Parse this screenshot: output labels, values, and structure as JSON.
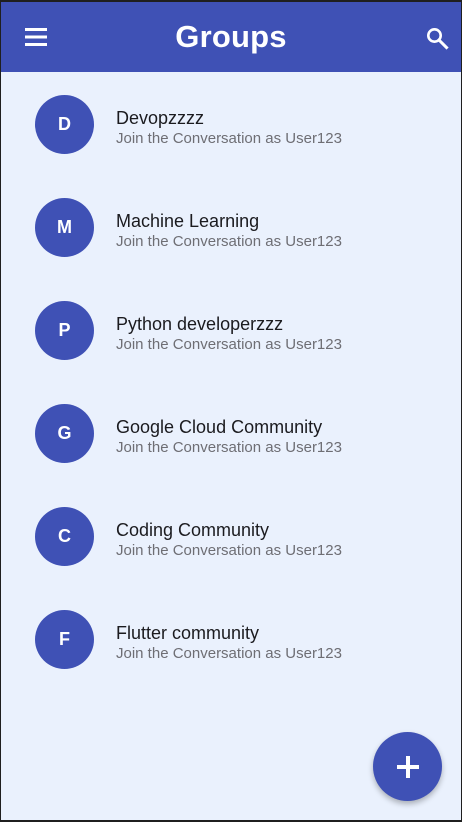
{
  "colors": {
    "primary": "#3f51b5",
    "background": "#eaf1fd",
    "on_primary": "#ffffff",
    "title_text": "#1b1b1f",
    "subtitle_text": "#6e6e74"
  },
  "app_bar": {
    "title": "Groups",
    "leading_icon": "menu-icon",
    "trailing_icon": "search-icon"
  },
  "groups": [
    {
      "initial": "D",
      "name": "Devopzzzz",
      "subtitle": "Join the Conversation as User123"
    },
    {
      "initial": "M",
      "name": "Machine Learning",
      "subtitle": "Join the Conversation as User123"
    },
    {
      "initial": "P",
      "name": "Python developerzzz",
      "subtitle": "Join the Conversation as User123"
    },
    {
      "initial": "G",
      "name": "Google Cloud Community",
      "subtitle": "Join the Conversation as User123"
    },
    {
      "initial": "C",
      "name": "Coding Community",
      "subtitle": "Join the Conversation as User123"
    },
    {
      "initial": "F",
      "name": "Flutter community",
      "subtitle": "Join the Conversation as User123"
    }
  ],
  "fab": {
    "icon": "add-icon"
  }
}
